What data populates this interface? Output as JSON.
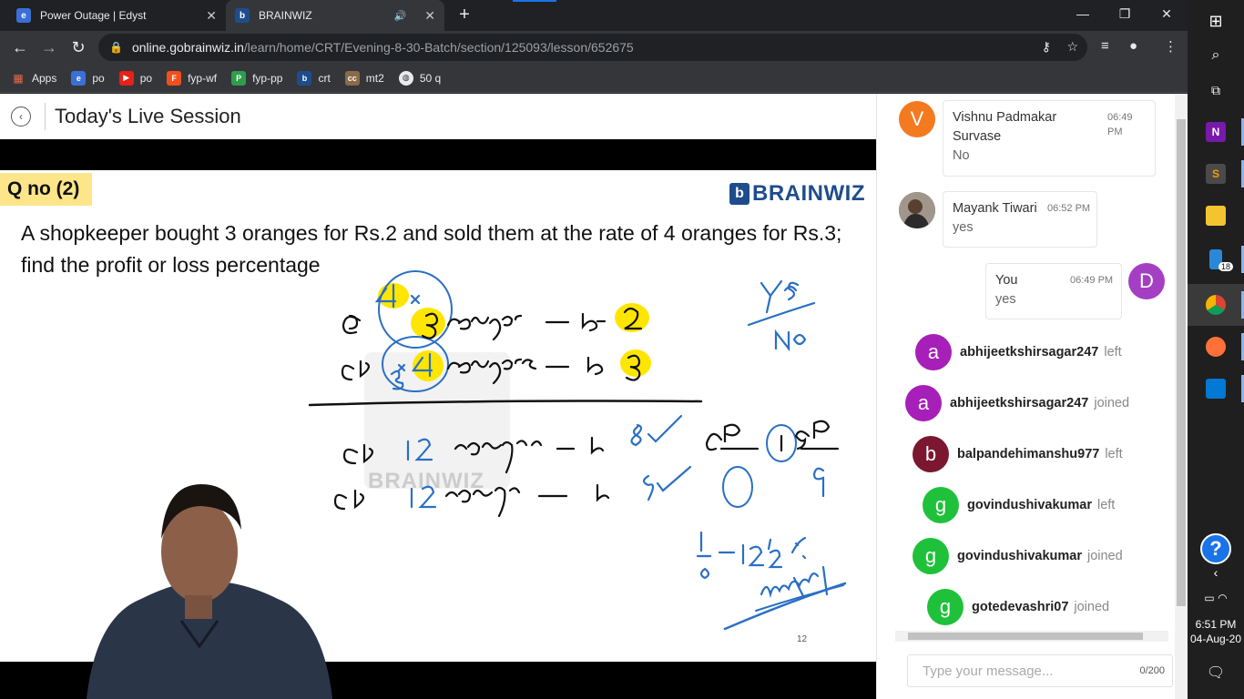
{
  "browser": {
    "tabs": [
      {
        "title": "Power Outage | Edyst",
        "active": false
      },
      {
        "title": "BRAINWIZ",
        "active": true
      }
    ],
    "url_domain": "online.gobrainwiz.in",
    "url_path": "/learn/home/CRT/Evening-8-30-Batch/section/125093/lesson/652675",
    "bookmarks": [
      "Apps",
      "po",
      "po",
      "fyp-wf",
      "fyp-pp",
      "crt",
      "mt2",
      "50 q"
    ]
  },
  "page": {
    "title": "Today's Live Session"
  },
  "slide": {
    "qno": "Q no (2)",
    "brand": "BRAINWIZ",
    "question": "A shopkeeper bought 3 oranges for Rs.2 and sold them at the rate of 4 oranges for Rs.3; find the profit or loss percentage",
    "page_number": "12",
    "watermark": "BRAINWIZ"
  },
  "chat": {
    "messages": [
      {
        "avatar": "V",
        "color": "#f47a20",
        "name": "Vishnu Padmakar Survase",
        "time": "06:49 PM",
        "text": "No"
      },
      {
        "avatar": "",
        "color": "#6b5a4e",
        "name": "Mayank Tiwari",
        "time": "06:52 PM",
        "text": "yes"
      },
      {
        "avatar": "D",
        "color": "#a43fc3",
        "name": "You",
        "time": "06:49 PM",
        "text": "yes"
      }
    ],
    "events": [
      {
        "avatar": "a",
        "color": "#a61fb8",
        "user": "abhijeetkshirsagar247",
        "action": "left"
      },
      {
        "avatar": "a",
        "color": "#a61fb8",
        "user": "abhijeetkshirsagar247",
        "action": "joined"
      },
      {
        "avatar": "b",
        "color": "#7b1730",
        "user": "balpandehimanshu977",
        "action": "left"
      },
      {
        "avatar": "g",
        "color": "#1fc13a",
        "user": "govindushivakumar",
        "action": "left"
      },
      {
        "avatar": "g",
        "color": "#1fc13a",
        "user": "govindushivakumar",
        "action": "joined"
      },
      {
        "avatar": "g",
        "color": "#1fc13a",
        "user": "gotedevashri07",
        "action": "joined"
      }
    ],
    "input_placeholder": "Type your message...",
    "char_count": "0/200"
  },
  "taskbar": {
    "time": "6:51 PM",
    "date": "04-Aug-20",
    "badge": "18"
  }
}
